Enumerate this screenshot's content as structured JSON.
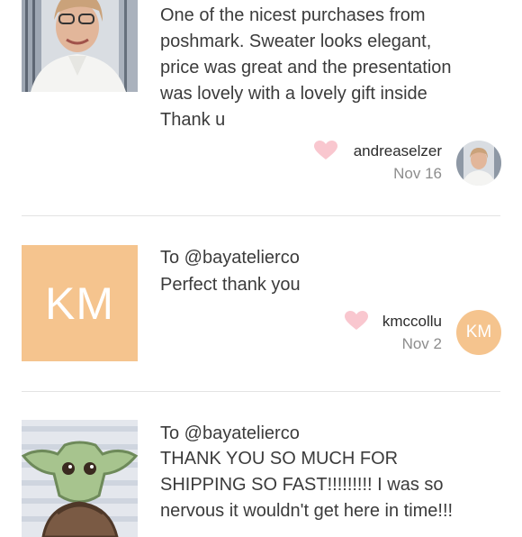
{
  "reviews": [
    {
      "title": "",
      "body_lines": [
        "One of the nicest purchases from",
        "poshmark. Sweater looks elegant,",
        "price was great and the presentation",
        "was lovely with a lovely gift inside",
        "Thank u"
      ],
      "username": "andreaselzer",
      "date": "Nov 16"
    },
    {
      "title": "To @bayatelierco",
      "body_lines": [
        "Perfect thank you"
      ],
      "thumb_initials": "KM",
      "avatar_initials": "KM",
      "username": "kmccollu",
      "date": "Nov 2"
    },
    {
      "title": "To @bayatelierco",
      "body_lines": [
        "THANK YOU SO MUCH FOR",
        "SHIPPING SO FAST!!!!!!!!! I was so",
        "nervous it wouldn't get here in time!!!"
      ]
    }
  ],
  "colors": {
    "heart": "#f9c7cf",
    "initials_bg": "#f5c48e",
    "divider": "#e3e3e3"
  }
}
